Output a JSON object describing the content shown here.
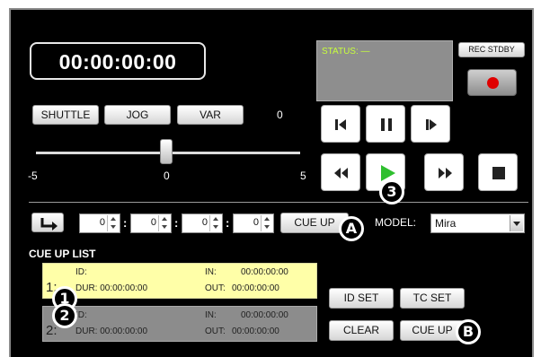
{
  "timecode": "00:00:00:00",
  "status": {
    "label": "STATUS: —",
    "color": "#c8ff3c"
  },
  "rec_standby": {
    "label": "REC STDBY",
    "indicator_color": "#e00000"
  },
  "shuttle_modes": {
    "shuttle": "SHUTTLE",
    "jog": "JOG",
    "var": "VAR"
  },
  "speed_value": "0",
  "slider": {
    "min_label": "-5",
    "center_label": "0",
    "max_label": "5",
    "value": 0
  },
  "transport": {
    "step_back_icon": "step-back-icon",
    "pause_icon": "pause-icon",
    "step_forward_icon": "step-forward-icon",
    "rewind_icon": "rewind-icon",
    "play_icon": "play-icon",
    "fast_forward_icon": "fast-forward-icon",
    "stop_icon": "stop-icon",
    "play_color": "#2fbf2f"
  },
  "cue_entry": {
    "hours": "0",
    "minutes": "0",
    "seconds": "0",
    "frames": "0",
    "cue_up_label": "CUE UP"
  },
  "model": {
    "label": "MODEL:",
    "value": "Mira"
  },
  "cue_list": {
    "title": "CUE UP LIST",
    "items": [
      {
        "num": "1:",
        "id_label": "ID:",
        "dur": "DUR: 00:00:00:00",
        "in_label": "IN:",
        "in_tc": "00:00:00:00",
        "out_label": "OUT:",
        "out_tc": "00:00:00:00",
        "color": "#ffffa8"
      },
      {
        "num": "2:",
        "id_label": "ID:",
        "dur": "DUR: 00:00:00:00",
        "in_label": "IN:",
        "in_tc": "00:00:00:00",
        "out_label": "OUT:",
        "out_tc": "00:00:00:00",
        "color": "#8c8c8c"
      }
    ],
    "buttons": {
      "id_set": "ID SET",
      "tc_set": "TC SET",
      "clear": "CLEAR",
      "cue_up": "CUE UP"
    }
  },
  "callouts": {
    "one": "1",
    "two": "2",
    "three": "3",
    "a": "A",
    "b": "B"
  }
}
